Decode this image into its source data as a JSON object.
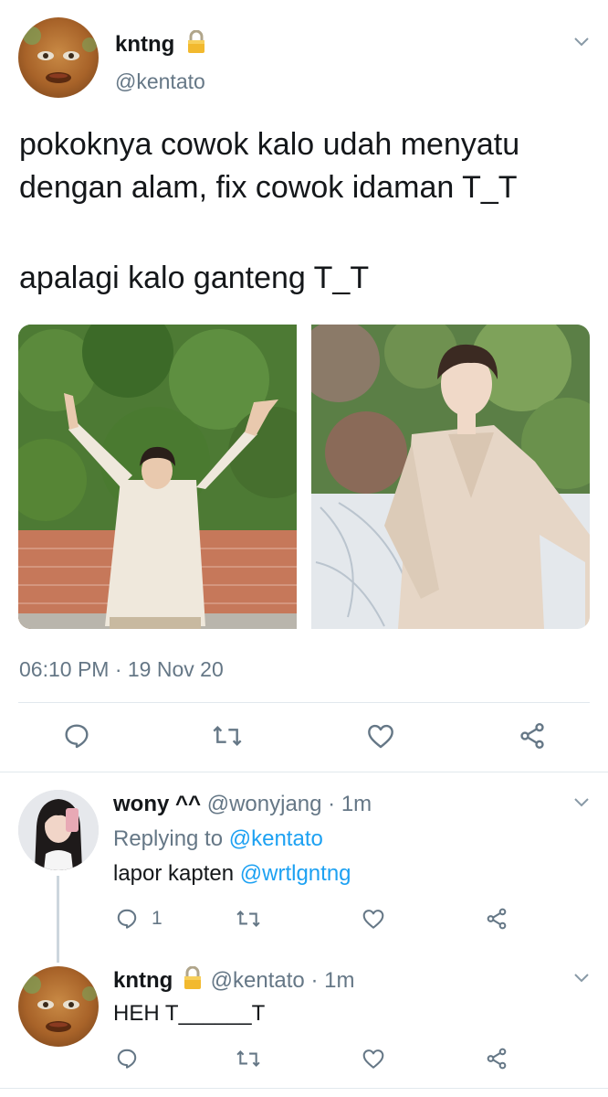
{
  "main_tweet": {
    "display_name": "kntng",
    "handle": "@kentato",
    "text_line1": "pokoknya cowok kalo udah menyatu",
    "text_line2": "dengan alam, fix cowok idaman T_T",
    "text_line3": "apalagi kalo ganteng T_T",
    "timestamp": "06:10 PM · 19 Nov 20"
  },
  "reply1": {
    "display_name": "wony ^^",
    "handle": "@wonyjang",
    "time": "· 1m",
    "replying_prefix": "Replying to",
    "replying_handle": "@kentato",
    "text": "lapor kapten",
    "mention": "@wrtlgntng",
    "reply_count": "1"
  },
  "reply2": {
    "display_name": "kntng",
    "handle": "@kentato",
    "time": "· 1m",
    "text": "HEH T______T"
  },
  "icons": {
    "reply": "reply-icon",
    "retweet": "retweet-icon",
    "like": "heart-icon",
    "share": "share-icon",
    "lock": "lock-icon",
    "menu": "chevron-down-icon"
  },
  "colors": {
    "link": "#1da1f2",
    "muted": "#657786",
    "divider": "#e1e8ed"
  }
}
